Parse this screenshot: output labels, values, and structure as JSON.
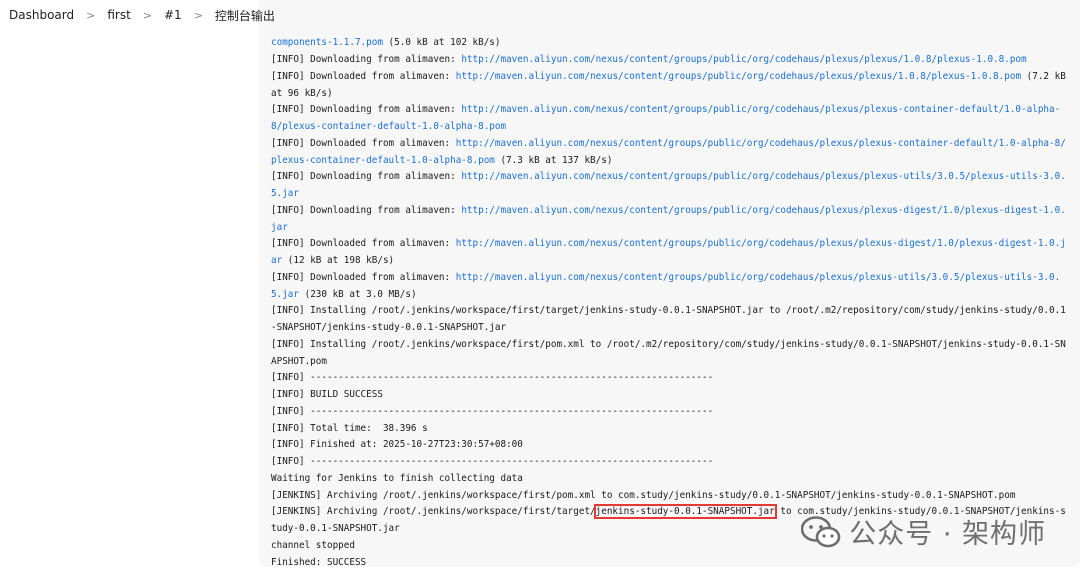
{
  "breadcrumb": {
    "items": [
      "Dashboard",
      "first",
      "#1",
      "控制台输出"
    ],
    "separator": ">"
  },
  "console": {
    "lines": [
      {
        "parts": [
          {
            "t": "components-1.1.7.pom",
            "link": true
          },
          {
            "t": " (5.0 kB at 102 kB/s)"
          }
        ]
      },
      {
        "parts": [
          {
            "t": "[INFO] Downloading from alimaven: "
          },
          {
            "t": "http://maven.aliyun.com/nexus/content/groups/public/org/codehaus/plexus/plexus/1.0.8/plexus-1.0.8.pom",
            "link": true
          }
        ]
      },
      {
        "parts": [
          {
            "t": "[INFO] Downloaded from alimaven: "
          },
          {
            "t": "http://maven.aliyun.com/nexus/content/groups/public/org/codehaus/plexus/plexus/1.0.8/plexus-1.0.8.pom",
            "link": true
          },
          {
            "t": " (7.2 kB at 96 kB/s)"
          }
        ]
      },
      {
        "parts": [
          {
            "t": "[INFO] Downloading from alimaven: "
          },
          {
            "t": "http://maven.aliyun.com/nexus/content/groups/public/org/codehaus/plexus/plexus-container-default/1.0-alpha-8/plexus-container-default-1.0-alpha-8.pom",
            "link": true
          }
        ]
      },
      {
        "parts": [
          {
            "t": "[INFO] Downloaded from alimaven: "
          },
          {
            "t": "http://maven.aliyun.com/nexus/content/groups/public/org/codehaus/plexus/plexus-container-default/1.0-alpha-8/plexus-container-default-1.0-alpha-8.pom",
            "link": true
          },
          {
            "t": " (7.3 kB at 137 kB/s)"
          }
        ]
      },
      {
        "parts": [
          {
            "t": "[INFO] Downloading from alimaven: "
          },
          {
            "t": "http://maven.aliyun.com/nexus/content/groups/public/org/codehaus/plexus/plexus-utils/3.0.5/plexus-utils-3.0.5.jar",
            "link": true
          }
        ]
      },
      {
        "parts": [
          {
            "t": "[INFO] Downloading from alimaven: "
          },
          {
            "t": "http://maven.aliyun.com/nexus/content/groups/public/org/codehaus/plexus/plexus-digest/1.0/plexus-digest-1.0.jar",
            "link": true
          }
        ]
      },
      {
        "parts": [
          {
            "t": "[INFO] Downloaded from alimaven: "
          },
          {
            "t": "http://maven.aliyun.com/nexus/content/groups/public/org/codehaus/plexus/plexus-digest/1.0/plexus-digest-1.0.jar",
            "link": true
          },
          {
            "t": " (12 kB at 198 kB/s)"
          }
        ]
      },
      {
        "parts": [
          {
            "t": "[INFO] Downloaded from alimaven: "
          },
          {
            "t": "http://maven.aliyun.com/nexus/content/groups/public/org/codehaus/plexus/plexus-utils/3.0.5/plexus-utils-3.0.5.jar",
            "link": true
          },
          {
            "t": " (230 kB at 3.0 MB/s)"
          }
        ]
      },
      {
        "parts": [
          {
            "t": "[INFO] Installing /root/.jenkins/workspace/first/target/jenkins-study-0.0.1-SNAPSHOT.jar to /root/.m2/repository/com/study/jenkins-study/0.0.1-SNAPSHOT/jenkins-study-0.0.1-SNAPSHOT.jar"
          }
        ]
      },
      {
        "parts": [
          {
            "t": "[INFO] Installing /root/.jenkins/workspace/first/pom.xml to /root/.m2/repository/com/study/jenkins-study/0.0.1-SNAPSHOT/jenkins-study-0.0.1-SNAPSHOT.pom"
          }
        ]
      },
      {
        "parts": [
          {
            "t": "[INFO] ------------------------------------------------------------------------"
          }
        ]
      },
      {
        "parts": [
          {
            "t": "[INFO] BUILD SUCCESS"
          }
        ]
      },
      {
        "parts": [
          {
            "t": "[INFO] ------------------------------------------------------------------------"
          }
        ]
      },
      {
        "parts": [
          {
            "t": "[INFO] Total time:  38.396 s"
          }
        ]
      },
      {
        "parts": [
          {
            "t": "[INFO] Finished at: 2025-10-27T23:30:57+08:00"
          }
        ]
      },
      {
        "parts": [
          {
            "t": "[INFO] ------------------------------------------------------------------------"
          }
        ]
      },
      {
        "parts": [
          {
            "t": "Waiting for Jenkins to finish collecting data"
          }
        ]
      },
      {
        "parts": [
          {
            "t": "[JENKINS] Archiving /root/.jenkins/workspace/first/pom.xml to com.study/jenkins-study/0.0.1-SNAPSHOT/jenkins-study-0.0.1-SNAPSHOT.pom"
          }
        ]
      },
      {
        "parts": [
          {
            "t": "[JENKINS] Archiving /root/.jenkins/workspace/first/target/"
          },
          {
            "t": "jenkins-study-0.0.1-SNAPSHOT.jar",
            "highlight": true
          },
          {
            "t": " to com.study/jenkins-study/0.0.1-SNAPSHOT/jenkins-study-0.0.1-SNAPSHOT.jar"
          }
        ]
      },
      {
        "parts": [
          {
            "t": "channel stopped"
          }
        ]
      },
      {
        "parts": [
          {
            "t": "Finished: SUCCESS"
          }
        ]
      }
    ]
  },
  "watermark": {
    "text": "公众号 · 架构师",
    "logo_icon": "wechat-icon"
  },
  "colors": {
    "link": "#1a6fd1",
    "highlight_border": "#e53935",
    "panel_bg": "#f7f7f8"
  }
}
